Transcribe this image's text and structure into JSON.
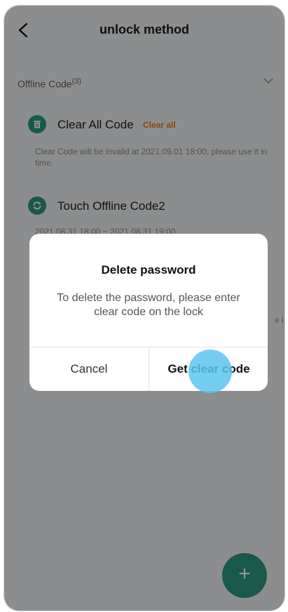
{
  "header": {
    "title": "unlock method"
  },
  "section": {
    "label": "Offline Code",
    "count": "(3)"
  },
  "rows": [
    {
      "title": "Clear All Code",
      "tag": "Clear all",
      "desc": "Clear Code will be invalid at 2021.09.01 18:00, please use it in time."
    },
    {
      "title": "Touch Offline Code2",
      "desc": "2021.08.31 18:00 ~ 2021.08.31 19:00",
      "partial_right": "e i"
    }
  ],
  "dialog": {
    "title": "Delete password",
    "message": "To delete the password, please enter clear code on the lock",
    "cancel_label": "Cancel",
    "confirm_label": "Get clear code"
  },
  "fab": {
    "label": "+"
  },
  "colors": {
    "accent": "#2a9a84",
    "tag": "#f07a16",
    "touch": "#5cc4f0"
  }
}
